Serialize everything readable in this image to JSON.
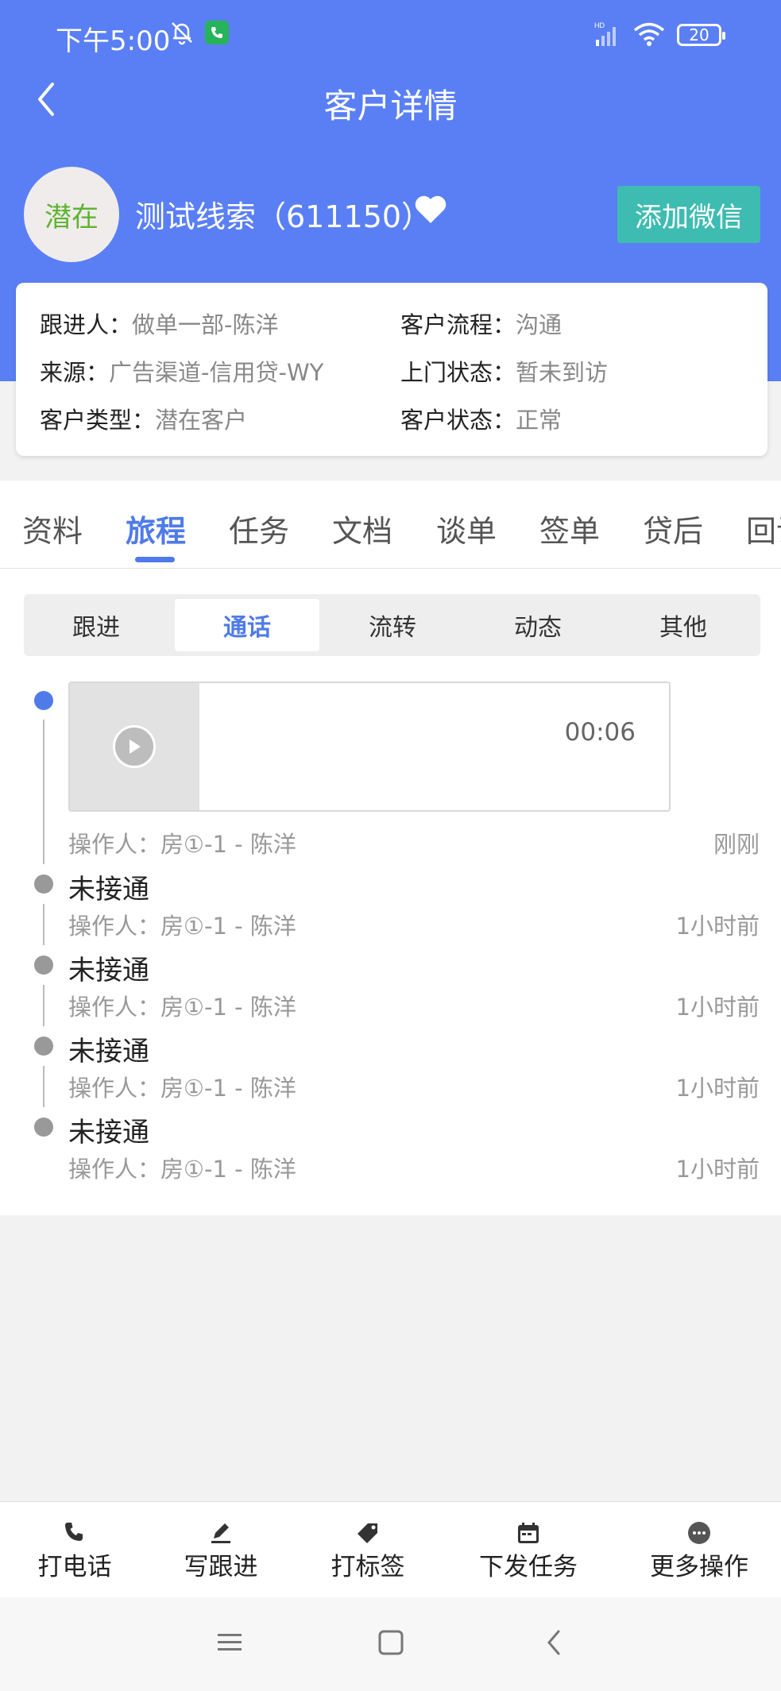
{
  "status_bar": {
    "time": "下午5:00",
    "hd_label": "HD",
    "battery": "20"
  },
  "header": {
    "title": "客户详情"
  },
  "customer": {
    "avatar_text": "潜在",
    "name": "测试线索（611150）",
    "wechat_button": "添加微信"
  },
  "info": [
    {
      "label": "跟进人：",
      "value": "做单一部-陈洋"
    },
    {
      "label": "客户流程：",
      "value": "沟通"
    },
    {
      "label": "来源：",
      "value": "广告渠道-信用贷-WY"
    },
    {
      "label": "上门状态：",
      "value": "暂未到访"
    },
    {
      "label": "客户类型：",
      "value": "潜在客户"
    },
    {
      "label": "客户状态：",
      "value": "正常"
    }
  ],
  "tabs": [
    "资料",
    "旅程",
    "任务",
    "文档",
    "谈单",
    "签单",
    "贷后",
    "回访"
  ],
  "active_tab": "旅程",
  "segments": [
    "跟进",
    "通话",
    "流转",
    "动态",
    "其他"
  ],
  "active_segment": "通话",
  "timeline": [
    {
      "kind": "audio",
      "duration": "00:06",
      "operator": "操作人：房①-1 - 陈洋",
      "time": "刚刚"
    },
    {
      "kind": "event",
      "title": "未接通",
      "operator": "操作人：房①-1 - 陈洋",
      "time": "1小时前"
    },
    {
      "kind": "event",
      "title": "未接通",
      "operator": "操作人：房①-1 - 陈洋",
      "time": "1小时前"
    },
    {
      "kind": "event",
      "title": "未接通",
      "operator": "操作人：房①-1 - 陈洋",
      "time": "1小时前"
    },
    {
      "kind": "event",
      "title": "未接通",
      "operator": "操作人：房①-1 - 陈洋",
      "time": "1小时前"
    }
  ],
  "bottom_bar": [
    {
      "label": "打电话",
      "icon": "phone-icon"
    },
    {
      "label": "写跟进",
      "icon": "pen-icon"
    },
    {
      "label": "打标签",
      "icon": "tag-icon"
    },
    {
      "label": "下发任务",
      "icon": "calendar-icon"
    },
    {
      "label": "更多操作",
      "icon": "more-icon"
    }
  ],
  "colors": {
    "primary": "#5a7ff5",
    "accent": "#4f7be9",
    "wechat": "#3ebcb1",
    "avatar_text": "#5cb531"
  }
}
